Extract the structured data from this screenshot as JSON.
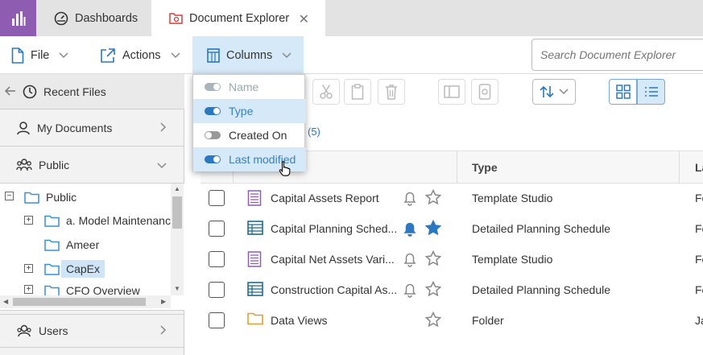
{
  "tabs": {
    "dashboards": "Dashboards",
    "document_explorer": "Document Explorer"
  },
  "toolbar": {
    "file": "File",
    "actions": "Actions",
    "columns": "Columns",
    "search_placeholder": "Search Document Explorer"
  },
  "columns_menu": [
    {
      "label": "Name",
      "state": "disabled"
    },
    {
      "label": "Type",
      "state": "on"
    },
    {
      "label": "Created On",
      "state": "off"
    },
    {
      "label": "Last modified",
      "state": "on"
    }
  ],
  "left_nav": {
    "recent_files": "Recent Files",
    "my_documents": "My Documents",
    "public": "Public",
    "users": "Users",
    "tree": [
      {
        "label": "Public",
        "level": 0,
        "expander": "minus"
      },
      {
        "label": "a. Model Maintenance",
        "level": 1,
        "expander": "plus"
      },
      {
        "label": "Ameer",
        "level": 1,
        "expander": "none"
      },
      {
        "label": "CapEx",
        "level": 1,
        "expander": "plus",
        "selected": true
      },
      {
        "label": "CFO Overview",
        "level": 1,
        "expander": "plus"
      }
    ]
  },
  "content": {
    "count": "(5)",
    "col_type": "Type",
    "col_last": "La",
    "rows": [
      {
        "name": "Capital Assets Report",
        "type": "Template Studio",
        "last": "Fe",
        "icon": "report-icon",
        "bell": "outline",
        "star": "outline"
      },
      {
        "name": "Capital Planning Sched...",
        "type": "Detailed Planning Schedule",
        "last": "Fe",
        "icon": "schedule-icon",
        "bell": "filled",
        "star": "filled"
      },
      {
        "name": "Capital Net Assets Vari...",
        "type": "Template Studio",
        "last": "Fe",
        "icon": "report-icon",
        "bell": "outline",
        "star": "outline"
      },
      {
        "name": "Construction Capital As...",
        "type": "Detailed Planning Schedule",
        "last": "Fe",
        "icon": "schedule-icon",
        "bell": "outline",
        "star": "outline"
      },
      {
        "name": "Data Views",
        "type": "Folder",
        "last": "Ja",
        "icon": "folder-icon",
        "bell": "none",
        "star": "outline"
      }
    ]
  },
  "colors": {
    "accent": "#2a78c2",
    "logo": "#8e5cb0",
    "selected_bg": "#d6e9f8"
  }
}
